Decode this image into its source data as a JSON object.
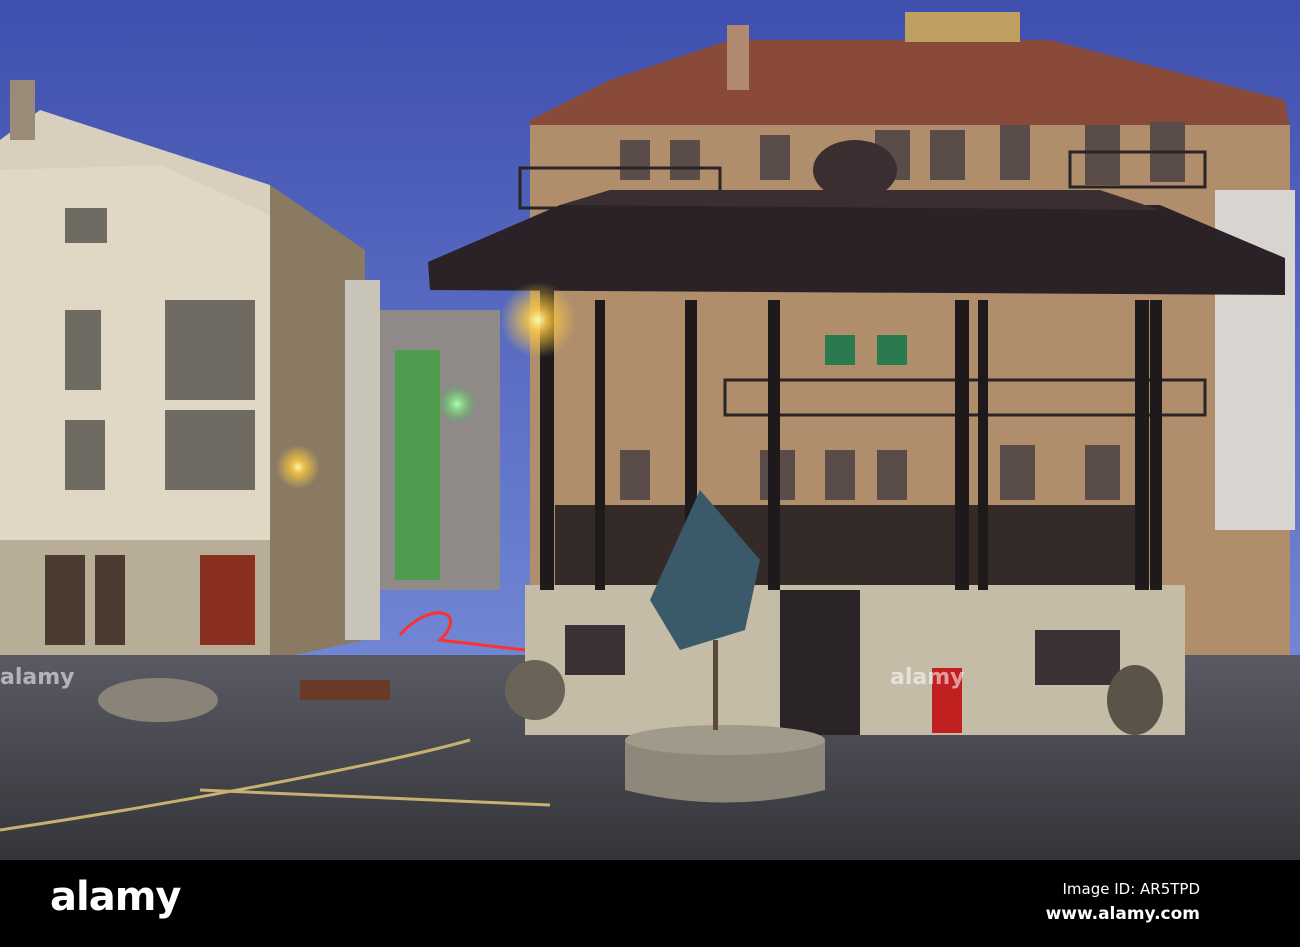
{
  "photo": {
    "subject": "photo",
    "colors": {
      "sky_top": "#3f4fae",
      "sky_bottom": "#7186d4",
      "plaza": "#4a4a52",
      "roof": "#2a2226"
    }
  },
  "watermark": {
    "logo": "alamy"
  },
  "footer": {
    "logo": "alamy",
    "image_id": "Image ID: AR5TPD",
    "url": "www.alamy.com"
  }
}
